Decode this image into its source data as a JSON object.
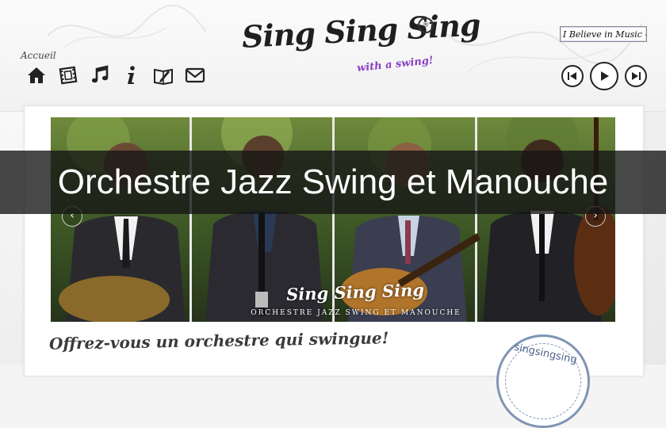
{
  "header": {
    "logo_text": "Sing Sing Sing",
    "logo_symbol": "®",
    "logo_tagline": "with a swing!",
    "nav_label": "Accueil",
    "nav_icons": [
      "home-icon",
      "film-icon",
      "music-note-icon",
      "info-icon",
      "guestbook-icon",
      "mail-icon"
    ]
  },
  "music_player": {
    "track_select": "I Believe in Music -",
    "buttons": [
      "previous-icon",
      "play-icon",
      "next-icon"
    ]
  },
  "slider": {
    "logo_text": "Sing Sing Sing",
    "subtitle": "ORCHESTRE JAZZ SWING ET MANOUCHE",
    "prev_arrow": "‹",
    "next_arrow": "›"
  },
  "overlay": {
    "title": "Orchestre Jazz Swing et Manouche"
  },
  "content": {
    "tagline": "Offrez-vous un orchestre qui swingue!",
    "stamp_text": "singsingsing"
  },
  "colors": {
    "overlay_background": "#141414",
    "logo_tagline_purple": "#8a3fc4",
    "stamp_blue": "#7f95b5",
    "slider_foliage": "#3b4a2a"
  }
}
